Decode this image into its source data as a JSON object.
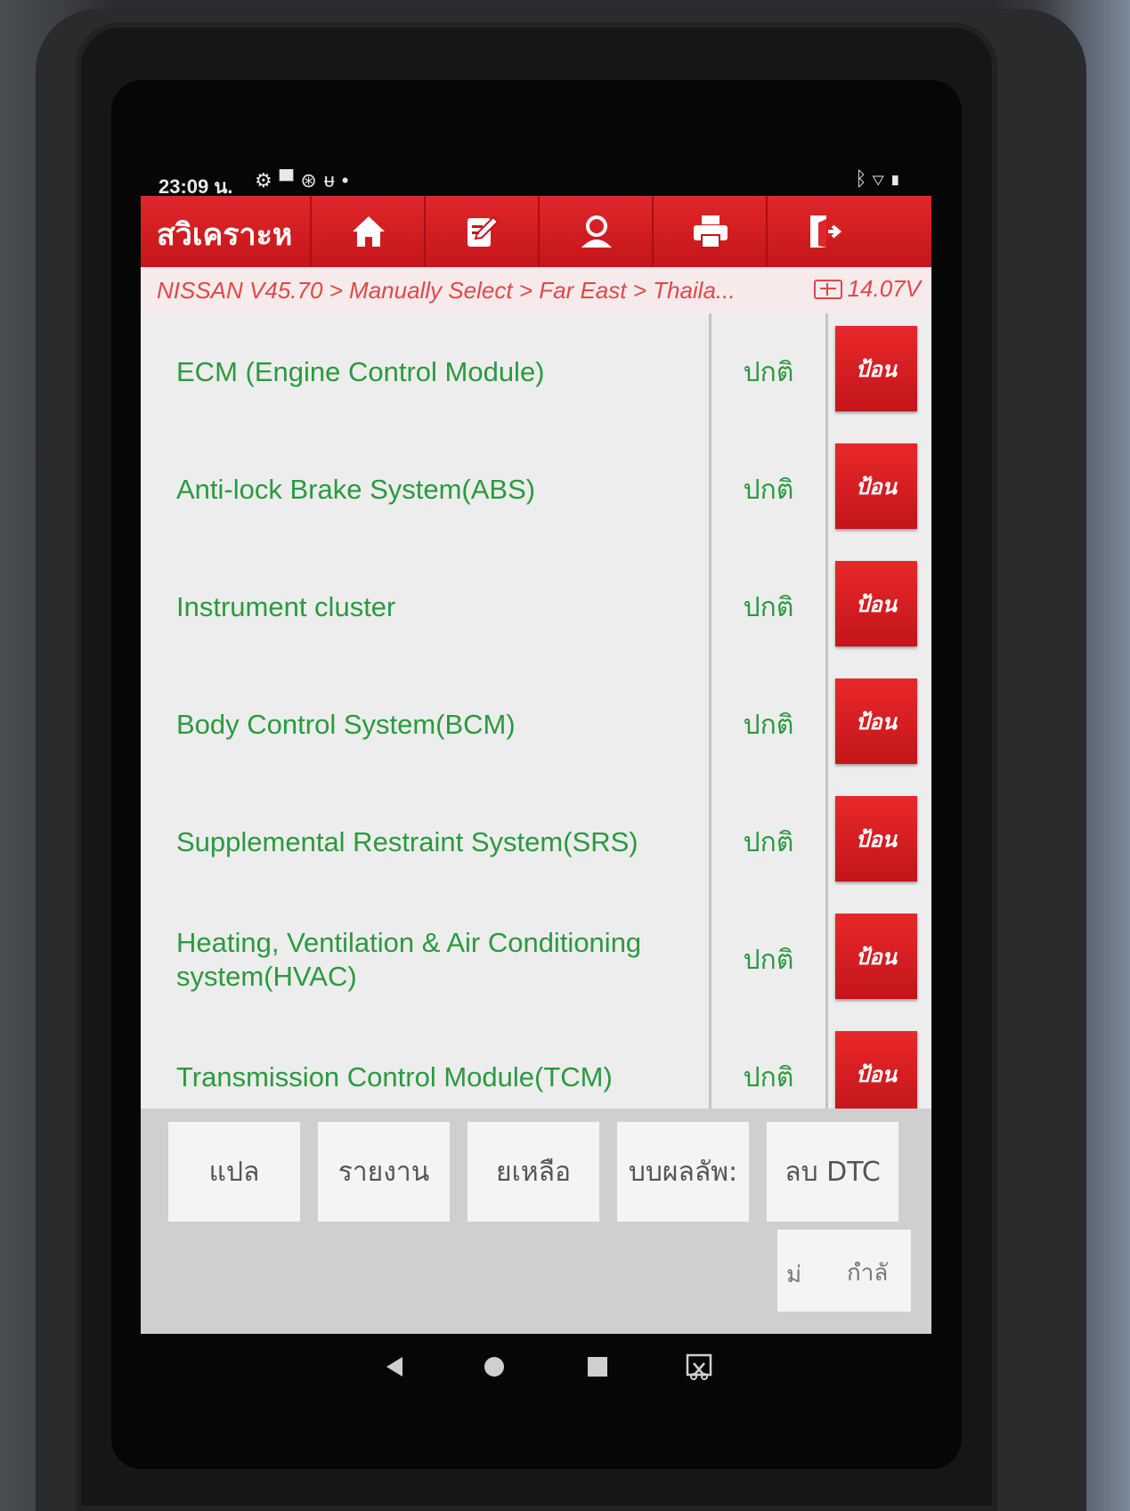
{
  "status_bar": {
    "time": "23:09 น.",
    "icons": [
      "gear-icon",
      "image-icon",
      "nfc-icon",
      "stethoscope-icon",
      "dot-icon"
    ],
    "right_icons": [
      "bluetooth-icon",
      "wifi-icon",
      "battery-icon"
    ]
  },
  "toolbar": {
    "title": "สวิเคราะห",
    "buttons": [
      "home-icon",
      "edit-icon",
      "user-icon",
      "printer-icon",
      "exit-icon"
    ]
  },
  "breadcrumb": {
    "path": "NISSAN V45.70 > Manually Select > Far East > Thaila...",
    "voltage": "14.07V"
  },
  "systems": [
    {
      "name": "ECM (Engine Control Module)",
      "status": "ปกติ",
      "action": "ป้อน"
    },
    {
      "name": "Anti-lock Brake System(ABS)",
      "status": "ปกติ",
      "action": "ป้อน"
    },
    {
      "name": "Instrument cluster",
      "status": "ปกติ",
      "action": "ป้อน"
    },
    {
      "name": "Body Control System(BCM)",
      "status": "ปกติ",
      "action": "ป้อน"
    },
    {
      "name": "Supplemental Restraint System(SRS)",
      "status": "ปกติ",
      "action": "ป้อน"
    },
    {
      "name": "Heating, Ventilation & Air Conditioning system(HVAC)",
      "status": "ปกติ",
      "action": "ป้อน"
    },
    {
      "name": "Transmission Control Module(TCM)",
      "status": "ปกติ",
      "action": "ป้อน"
    }
  ],
  "bottom_buttons": [
    "แปล",
    "รายงาน",
    "ยเหลือ",
    "บบผลลัพ:",
    "ลบ DTC"
  ],
  "toggle": {
    "left": "ม่",
    "right": "กำลั"
  },
  "nav": [
    "back-icon",
    "home-circle-icon",
    "recents-icon",
    "screenshot-icon"
  ],
  "colors": {
    "accent_red": "#d61e22",
    "status_green": "#2a9a3e",
    "crumb_red": "#e2474a"
  }
}
